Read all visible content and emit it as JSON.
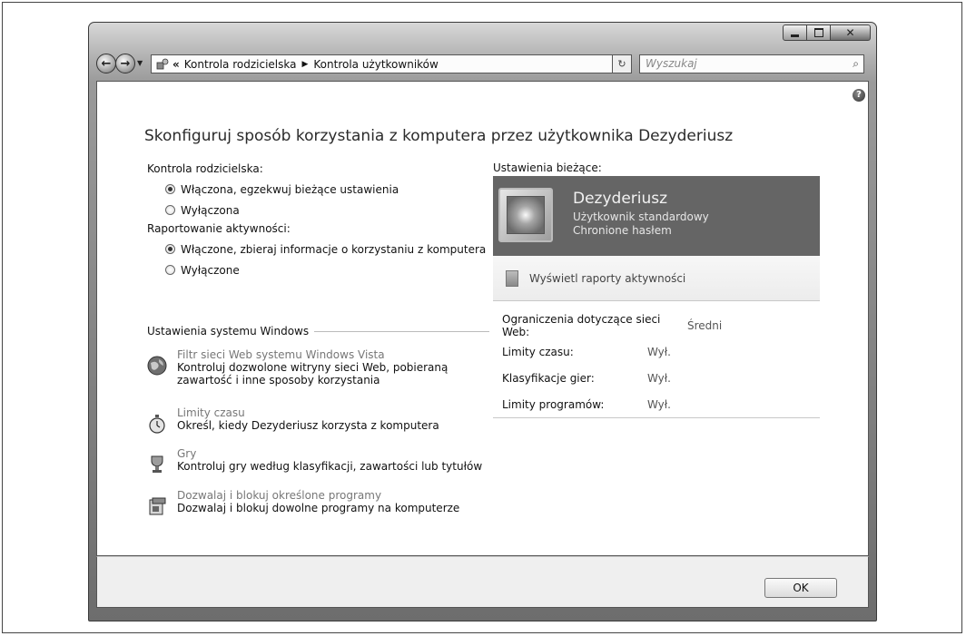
{
  "nav": {
    "back_label": "←",
    "forward_label": "→",
    "chevron": "«",
    "breadcrumbs": [
      "Kontrola rodzicielska",
      "Kontrola użytkowników"
    ],
    "crumb_sep": "▶",
    "dropdown": "▼",
    "refresh": "↻",
    "search_placeholder": "Wyszukaj",
    "search_icon": "⌕"
  },
  "caption": {
    "close": "✕"
  },
  "help": {
    "label": "?"
  },
  "main": {
    "title": "Skonfiguruj sposób korzystania z komputera przez użytkownika Dezyderiusz"
  },
  "parental_control": {
    "label": "Kontrola rodzicielska:",
    "options": [
      {
        "label": "Włączona, egzekwuj bieżące ustawienia",
        "checked": true
      },
      {
        "label": "Wyłączona",
        "checked": false
      }
    ]
  },
  "activity_reporting": {
    "label": "Raportowanie aktywności:",
    "options": [
      {
        "label": "Włączone, zbieraj informacje o korzystaniu z komputera",
        "checked": true
      },
      {
        "label": "Wyłączone",
        "checked": false
      }
    ]
  },
  "windows_settings": {
    "label": "Ustawienia systemu Windows",
    "items": [
      {
        "title": "Filtr sieci Web systemu Windows Vista",
        "desc_line1": "Kontroluj dozwolone witryny sieci Web, pobieraną",
        "desc_line2": "zawartość i inne sposoby korzystania",
        "icon": "globe-icon"
      },
      {
        "title": "Limity czasu",
        "desc_line1": "Określ, kiedy Dezyderiusz korzysta z komputera",
        "icon": "stopwatch-icon"
      },
      {
        "title": "Gry",
        "desc_line1": "Kontroluj gry według klasyfikacji, zawartości lub tytułów",
        "icon": "trophy-icon"
      },
      {
        "title": "Dozwalaj i blokuj określone programy",
        "desc_line1": "Dozwalaj i blokuj dowolne programy na komputerze",
        "icon": "program-icon"
      }
    ]
  },
  "current_settings": {
    "label": "Ustawienia bieżące:",
    "user": {
      "name": "Dezyderiusz",
      "role": "Użytkownik standardowy",
      "password": "Chronione hasłem"
    },
    "activity_link": "Wyświetl raporty aktywności",
    "limits": [
      {
        "label": "Ograniczenia dotyczące sieci Web:",
        "value": "Średni"
      },
      {
        "label": "Limity czasu:",
        "value": "Wył."
      },
      {
        "label": "Klasyfikacje gier:",
        "value": "Wył."
      },
      {
        "label": "Limity programów:",
        "value": "Wył."
      }
    ]
  },
  "footer": {
    "ok_label": "OK"
  }
}
